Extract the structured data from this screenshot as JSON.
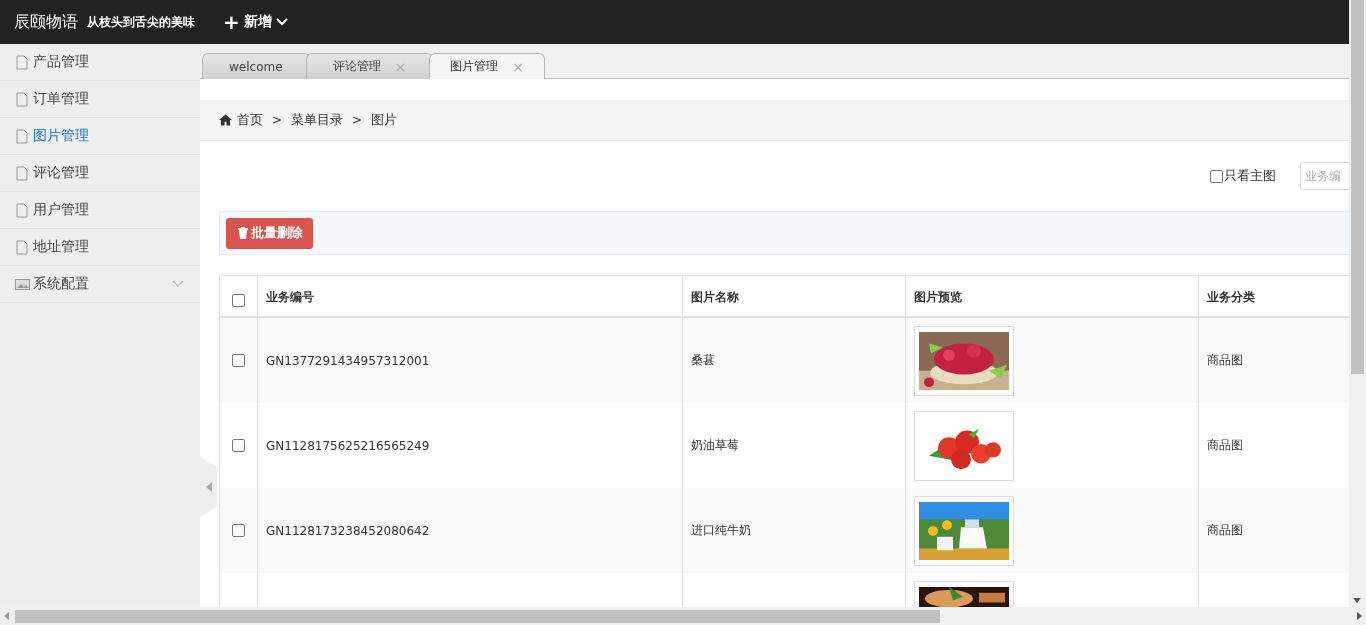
{
  "header": {
    "brand": "辰颐物语",
    "slogan": "从枝头到舌尖的美味",
    "add_icon": "+",
    "add_label": "新增"
  },
  "sidebar": {
    "items": [
      {
        "kind": "page",
        "label": "产品管理",
        "selected": false
      },
      {
        "kind": "page",
        "label": "订单管理",
        "selected": false
      },
      {
        "kind": "page",
        "label": "图片管理",
        "selected": true
      },
      {
        "kind": "page",
        "label": "评论管理",
        "selected": false
      },
      {
        "kind": "page",
        "label": "用户管理",
        "selected": false
      },
      {
        "kind": "page",
        "label": "地址管理",
        "selected": false
      },
      {
        "kind": "group",
        "label": "系统配置",
        "selected": false,
        "expanded": false
      }
    ]
  },
  "tabs": [
    {
      "label": "welcome",
      "selected": false
    },
    {
      "label": "评论管理",
      "close": "×",
      "selected": false
    },
    {
      "label": "图片管理",
      "close": "×",
      "selected": true
    }
  ],
  "breadcrumb": [
    {
      "label": "首页",
      "kind": "home"
    },
    {
      "label": ">",
      "kind": "sep"
    },
    {
      "label": "菜单目录",
      "kind": "link"
    },
    {
      "label": ">",
      "kind": "sep"
    },
    {
      "label": "图片",
      "kind": "current"
    }
  ],
  "filter": {
    "main_only": {
      "label": "只看主图",
      "checked": false
    },
    "search": {
      "placeholder": "业务编"
    }
  },
  "batch_delete": {
    "label": "批量删除"
  },
  "table": {
    "select_all": {
      "checked": false
    },
    "columns": [
      "业务编号",
      "图片名称",
      "图片预览",
      "业务分类"
    ],
    "rows": [
      {
        "checked": false,
        "code": "GN1377291434957312001",
        "name": "桑葚",
        "preview": {
          "kind": "picture"
        },
        "category": "商品图"
      },
      {
        "checked": false,
        "code": "GN1128175625216565249",
        "name": "奶油草莓",
        "preview": {
          "kind": "picture"
        },
        "category": "商品图"
      },
      {
        "checked": false,
        "code": "GN1128173238452080642",
        "name": "进口纯牛奶",
        "preview": {
          "kind": "picture"
        },
        "category": "商品图"
      },
      {
        "preview": {
          "kind": "picture"
        }
      }
    ]
  }
}
